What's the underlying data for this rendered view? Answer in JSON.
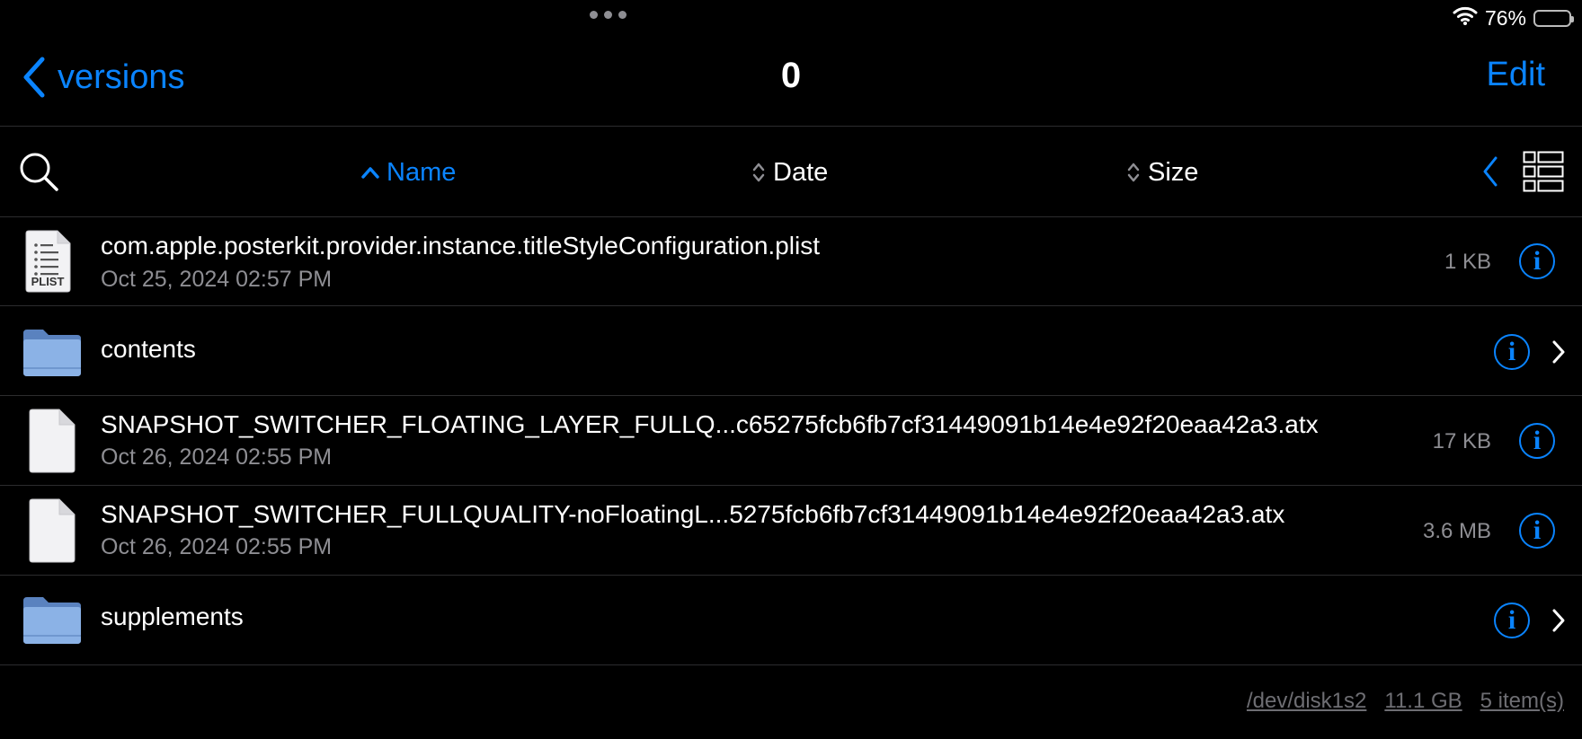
{
  "status_bar": {
    "battery_percent": "76%",
    "battery_level": 0.76,
    "icons": [
      "wifi-icon",
      "battery-icon",
      "multitasking-dots"
    ]
  },
  "nav": {
    "back_label": "versions",
    "title": "0",
    "edit_label": "Edit"
  },
  "sort_bar": {
    "name_label": "Name",
    "date_label": "Date",
    "size_label": "Size",
    "active_sort": "Name",
    "icons": [
      "search-icon",
      "sort-ascending-icon",
      "sort-updown-icon",
      "chevron-left-icon",
      "list-view-icon"
    ]
  },
  "files": [
    {
      "name": "com.apple.posterkit.provider.instance.titleStyleConfiguration.plist",
      "date": "Oct 25, 2024 02:57 PM",
      "size": "1 KB",
      "icon": "plist-file-icon",
      "icon_label": "PLIST"
    },
    {
      "name": "contents",
      "icon": "folder-icon"
    },
    {
      "name": "SNAPSHOT_SWITCHER_FLOATING_LAYER_FULLQ...c65275fcb6fb7cf31449091b14e4e92f20eaa42a3.atx",
      "date": "Oct 26, 2024 02:55 PM",
      "size": "17 KB",
      "icon": "document-icon"
    },
    {
      "name": "SNAPSHOT_SWITCHER_FULLQUALITY-noFloatingL...5275fcb6fb7cf31449091b14e4e92f20eaa42a3.atx",
      "date": "Oct 26, 2024 02:55 PM",
      "size": "3.6 MB",
      "icon": "document-icon"
    },
    {
      "name": "supplements",
      "icon": "folder-icon"
    }
  ],
  "info_glyph": "i",
  "footer": {
    "disk": "/dev/disk1s2",
    "free_space": "11.1 GB",
    "item_count": "5 item(s)"
  },
  "colors": {
    "accent": "#0a84ff",
    "background": "#000000",
    "secondary_text": "#8e8e93",
    "folder": "#7ea7e0"
  }
}
